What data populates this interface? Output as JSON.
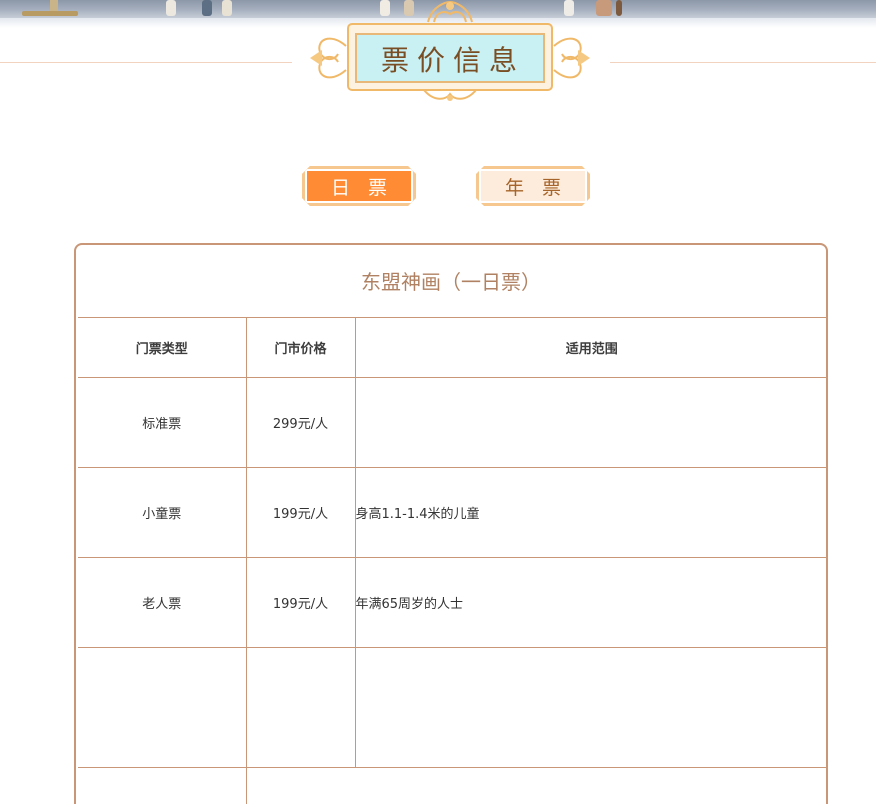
{
  "section": {
    "title": "票价信息"
  },
  "tabs": [
    {
      "label": "日 票",
      "active": true
    },
    {
      "label": "年 票",
      "active": false
    }
  ],
  "ticket_table": {
    "title": "东盟神画（一日票）",
    "headers": [
      "门票类型",
      "门市价格",
      "适用范围"
    ],
    "rows": [
      {
        "type": "标准票",
        "price": "299元/人",
        "scope": ""
      },
      {
        "type": "小童票",
        "price": "199元/人",
        "scope": "身高1.1-1.4米的儿童"
      },
      {
        "type": "老人票",
        "price": "199元/人",
        "scope": "年满65周岁的人士"
      }
    ]
  },
  "colors": {
    "accent": "#ff8c35",
    "border": "#c99677",
    "title_text": "#7a4e24",
    "title_panel": "#c9f1f4",
    "card_title": "#b08263"
  }
}
